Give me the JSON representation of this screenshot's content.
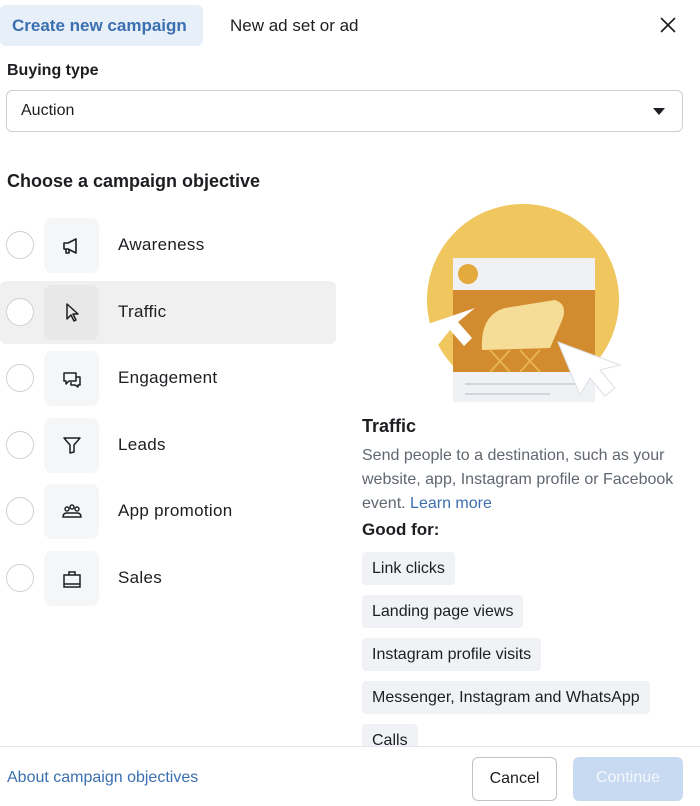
{
  "tabs": [
    {
      "label": "Create new campaign",
      "active": true
    },
    {
      "label": "New ad set or ad",
      "active": false
    }
  ],
  "buying_type": {
    "label": "Buying type",
    "value": "Auction"
  },
  "objective": {
    "heading": "Choose a campaign objective",
    "selected": "Traffic",
    "items": [
      {
        "label": "Awareness",
        "icon": "megaphone-icon"
      },
      {
        "label": "Traffic",
        "icon": "cursor-icon"
      },
      {
        "label": "Engagement",
        "icon": "chat-bubbles-icon"
      },
      {
        "label": "Leads",
        "icon": "funnel-icon"
      },
      {
        "label": "App promotion",
        "icon": "people-icon"
      },
      {
        "label": "Sales",
        "icon": "shopping-bag-icon"
      }
    ]
  },
  "detail": {
    "title": "Traffic",
    "description": "Send people to a destination, such as your website, app, Instagram profile or Facebook event.",
    "learn_more": "Learn more",
    "good_for_label": "Good for:",
    "good_for": [
      "Link clicks",
      "Landing page views",
      "Instagram profile visits",
      "Messenger, Instagram and WhatsApp",
      "Calls"
    ]
  },
  "footer": {
    "link": "About campaign objectives",
    "cancel": "Cancel",
    "continue": "Continue"
  },
  "colors": {
    "accent": "#3b6fb0",
    "tab_bg": "#e7eff9",
    "continue_disabled": "#c7daf2",
    "illustration": "#f0c75e"
  }
}
